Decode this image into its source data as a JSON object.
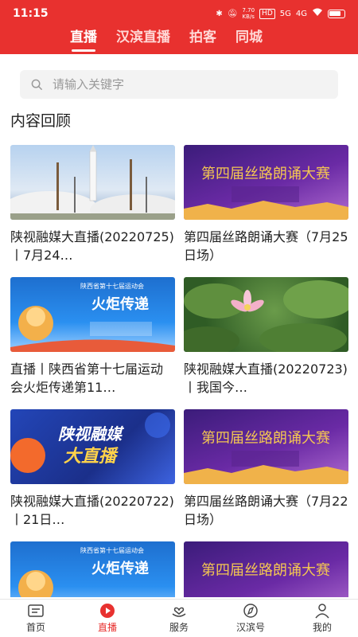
{
  "status": {
    "time": "11:15",
    "speed_top": "7.70",
    "speed_unit": "KB/s",
    "hd": "HD",
    "net1": "5G",
    "net2": "4G"
  },
  "tabs": [
    {
      "label": "直播"
    },
    {
      "label": "汉滨直播"
    },
    {
      "label": "拍客"
    },
    {
      "label": "同城"
    }
  ],
  "search": {
    "placeholder": "请输入关键字"
  },
  "section_title": "内容回顾",
  "cards": [
    {
      "title": "陕视融媒大直播(20220725)丨7月24…",
      "thumb": "rocket-launch-image"
    },
    {
      "title": "第四届丝路朗诵大赛（7月25日场）",
      "thumb": "recital-contest-banner"
    },
    {
      "title": "直播丨陕西省第十七届运动会火炬传递第11…",
      "thumb": "torch-relay-banner"
    },
    {
      "title": "陕视融媒大直播(20220723)丨我国今…",
      "thumb": "lotus-image"
    },
    {
      "title": "陕视融媒大直播(20220722)丨21日…",
      "thumb": "media-live-banner"
    },
    {
      "title": "第四届丝路朗诵大赛（7月22日场）",
      "thumb": "recital-contest-banner"
    },
    {
      "title": "",
      "thumb": "torch-relay-banner"
    },
    {
      "title": "",
      "thumb": "recital-contest-banner"
    }
  ],
  "banner_text": {
    "recital": "第四届丝路朗诵大赛",
    "torch": "火炬传递",
    "torch_sub": "陕西省第十七届运动会",
    "media": "陕视融媒",
    "media2": "大直播"
  },
  "bottom_nav": [
    {
      "label": "首页",
      "icon": "news-icon"
    },
    {
      "label": "直播",
      "icon": "play-icon"
    },
    {
      "label": "服务",
      "icon": "heart-hand-icon"
    },
    {
      "label": "汉滨号",
      "icon": "compass-icon"
    },
    {
      "label": "我的",
      "icon": "person-icon"
    }
  ],
  "colors": {
    "accent": "#e8312f"
  }
}
